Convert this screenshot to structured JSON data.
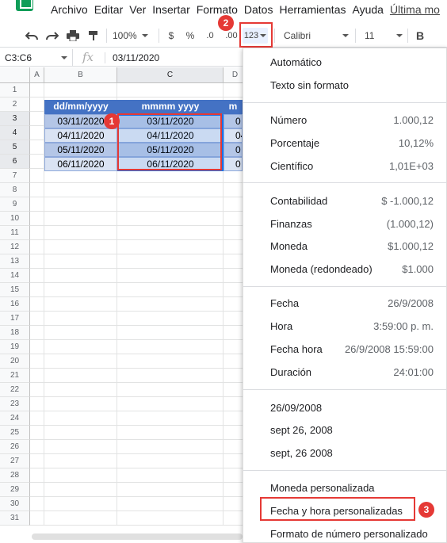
{
  "menu": {
    "items": [
      "Archivo",
      "Editar",
      "Ver",
      "Insertar",
      "Formato",
      "Datos",
      "Herramientas",
      "Ayuda",
      "Última mo"
    ]
  },
  "toolbar": {
    "zoom": "100%",
    "currency": "$",
    "percent": "%",
    "dec_minus": ".0",
    "dec_plus": ".00",
    "more_formats": "123",
    "font": "Calibri",
    "font_size": "11",
    "bold": "B"
  },
  "formula_bar": {
    "name_box": "C3:C6",
    "fx": "fx",
    "value": "03/11/2020"
  },
  "columns": [
    "A",
    "B",
    "C",
    "D"
  ],
  "rows": [
    "1",
    "2",
    "3",
    "4",
    "5",
    "6",
    "7",
    "8",
    "9",
    "10",
    "11",
    "12",
    "13",
    "14",
    "15",
    "16",
    "17",
    "18",
    "19",
    "20",
    "21",
    "22",
    "23",
    "24",
    "25",
    "26",
    "27",
    "28",
    "29",
    "30",
    "31"
  ],
  "table": {
    "headers": [
      "dd/mm/yyyy",
      "mmmm yyyy",
      "m"
    ],
    "col_b": [
      "03/11/2020",
      "04/11/2020",
      "05/11/2020",
      "06/11/2020"
    ],
    "col_c": [
      "03/11/2020",
      "04/11/2020",
      "05/11/2020",
      "06/11/2020"
    ],
    "col_d": [
      "0",
      "04",
      "0",
      "0"
    ]
  },
  "badges": [
    "1",
    "2",
    "3"
  ],
  "dropdown": {
    "group1": [
      {
        "label": "Automático",
        "example": ""
      },
      {
        "label": "Texto sin formato",
        "example": ""
      }
    ],
    "group2": [
      {
        "label": "Número",
        "example": "1.000,12"
      },
      {
        "label": "Porcentaje",
        "example": "10,12%"
      },
      {
        "label": "Científico",
        "example": "1,01E+03"
      }
    ],
    "group3": [
      {
        "label": "Contabilidad",
        "example": "$ -1.000,12"
      },
      {
        "label": "Finanzas",
        "example": "(1.000,12)"
      },
      {
        "label": "Moneda",
        "example": "$1.000,12"
      },
      {
        "label": "Moneda (redondeado)",
        "example": "$1.000"
      }
    ],
    "group4": [
      {
        "label": "Fecha",
        "example": "26/9/2008"
      },
      {
        "label": "Hora",
        "example": "3:59:00 p. m."
      },
      {
        "label": "Fecha hora",
        "example": "26/9/2008 15:59:00"
      },
      {
        "label": "Duración",
        "example": "24:01:00"
      }
    ],
    "group5": [
      {
        "label": "26/09/2008",
        "example": ""
      },
      {
        "label": "sept 26, 2008",
        "example": ""
      },
      {
        "label": "sept, 26 2008",
        "example": ""
      }
    ],
    "group6": [
      {
        "label": "Moneda personalizada",
        "example": ""
      },
      {
        "label": "Fecha y hora personalizadas",
        "example": ""
      },
      {
        "label": "Formato de número personalizado",
        "example": ""
      }
    ]
  },
  "colors": {
    "header_blue": "#4472c4",
    "band_dark": "#b4c6e7",
    "band_light": "#dae3f3",
    "highlight_red": "#e53935",
    "selection_blue": "#1a73e8"
  }
}
